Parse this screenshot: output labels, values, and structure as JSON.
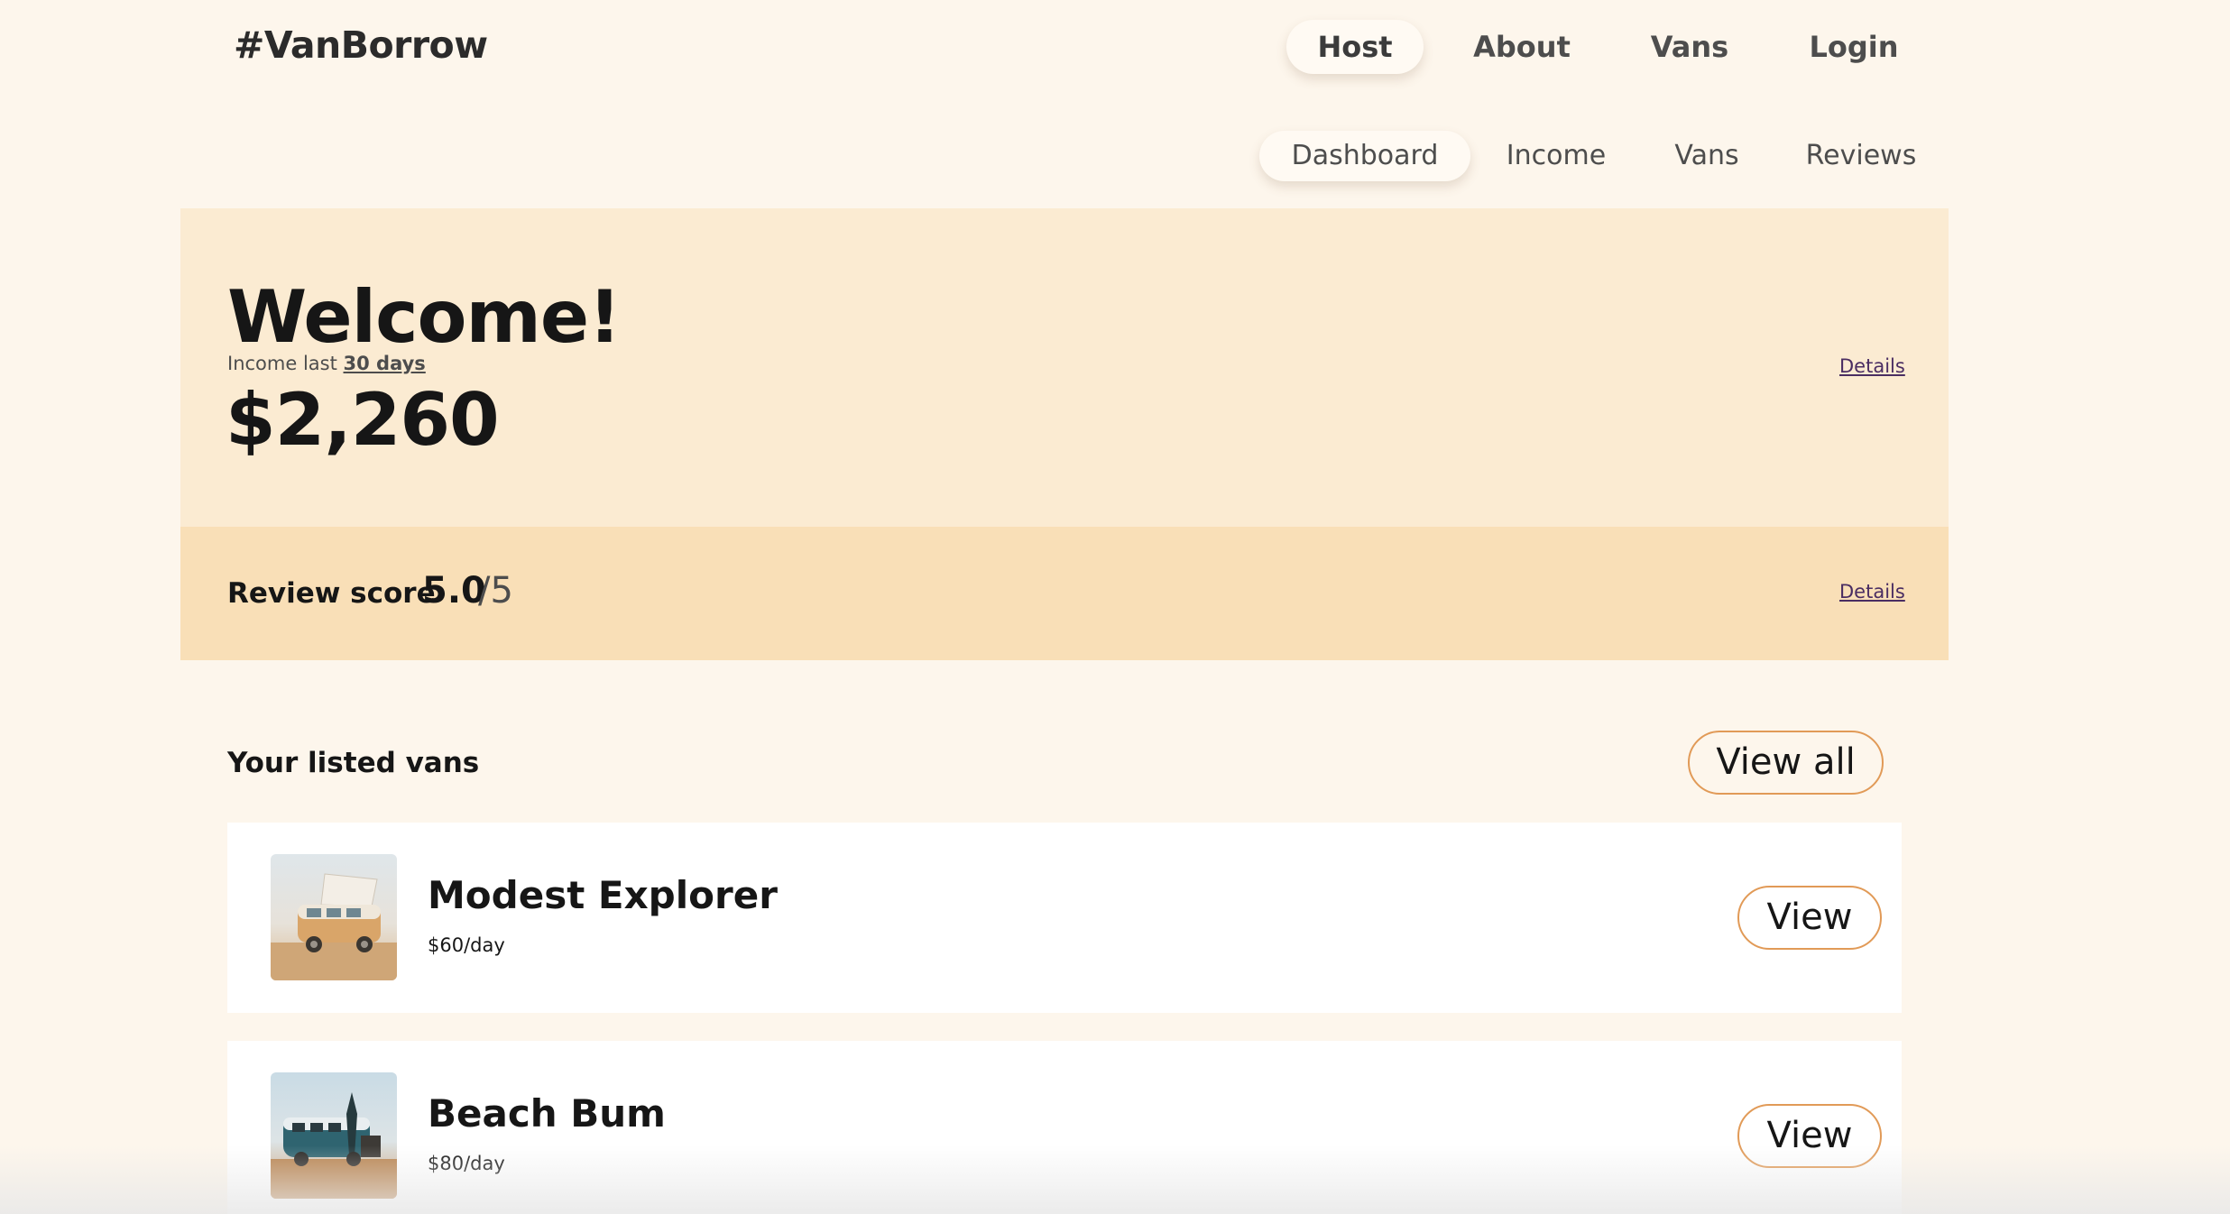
{
  "header": {
    "logo": "#VanBorrow",
    "nav": [
      "Host",
      "About",
      "Vans",
      "Login"
    ],
    "active_nav": "Host"
  },
  "subnav": {
    "items": [
      "Dashboard",
      "Income",
      "Vans",
      "Reviews"
    ],
    "active": "Dashboard"
  },
  "welcome": {
    "title": "Welcome!",
    "income_prefix": "Income last",
    "income_period": "30 days",
    "income_amount": "$2,260",
    "details_label": "Details"
  },
  "review": {
    "label": "Review score",
    "score": "5.0",
    "out_of": "/5",
    "details_label": "Details"
  },
  "listed": {
    "title": "Your listed vans",
    "view_all_label": "View all",
    "vans": [
      {
        "name": "Modest Explorer",
        "price": "$60/day",
        "view_label": "View"
      },
      {
        "name": "Beach Bum",
        "price": "$80/day",
        "view_label": "View"
      }
    ]
  },
  "colors": {
    "background": "#FDF6EC",
    "welcome_panel": "#FBEBD2",
    "review_panel": "#F9DFB7",
    "button_border": "#E19A57",
    "link": "#4a2d62"
  }
}
